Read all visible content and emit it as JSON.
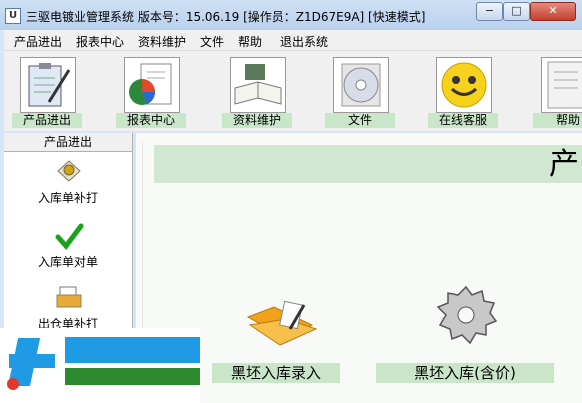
{
  "window": {
    "title": "三驱电镀业管理系统   版本号：15.06.19   [操作员：Z1D67E9A]  [快速模式]",
    "app_icon_glyph": "U",
    "min_glyph": "−",
    "max_glyph": "□",
    "close_glyph": "✕"
  },
  "menu": [
    "产品进出",
    "报表中心",
    "资料维护",
    "文件",
    "帮助",
    "退出系统"
  ],
  "toolbar": [
    "产品进出",
    "报表中心",
    "资料维护",
    "文件",
    "在线客服",
    "帮助"
  ],
  "left_panel": {
    "header": "产品进出",
    "items": [
      "入库单补打",
      "入库单对单",
      "出仓单补打"
    ]
  },
  "main": {
    "banner_text": "产",
    "items": [
      "黑坯入库录入",
      "黑坯入库(含价)"
    ]
  },
  "colors": {
    "label_green": "#c9e6c9",
    "banner_green": "#cfe8cf",
    "watermark_blue": "#1e9be4",
    "watermark_green": "#2e8a2e"
  }
}
